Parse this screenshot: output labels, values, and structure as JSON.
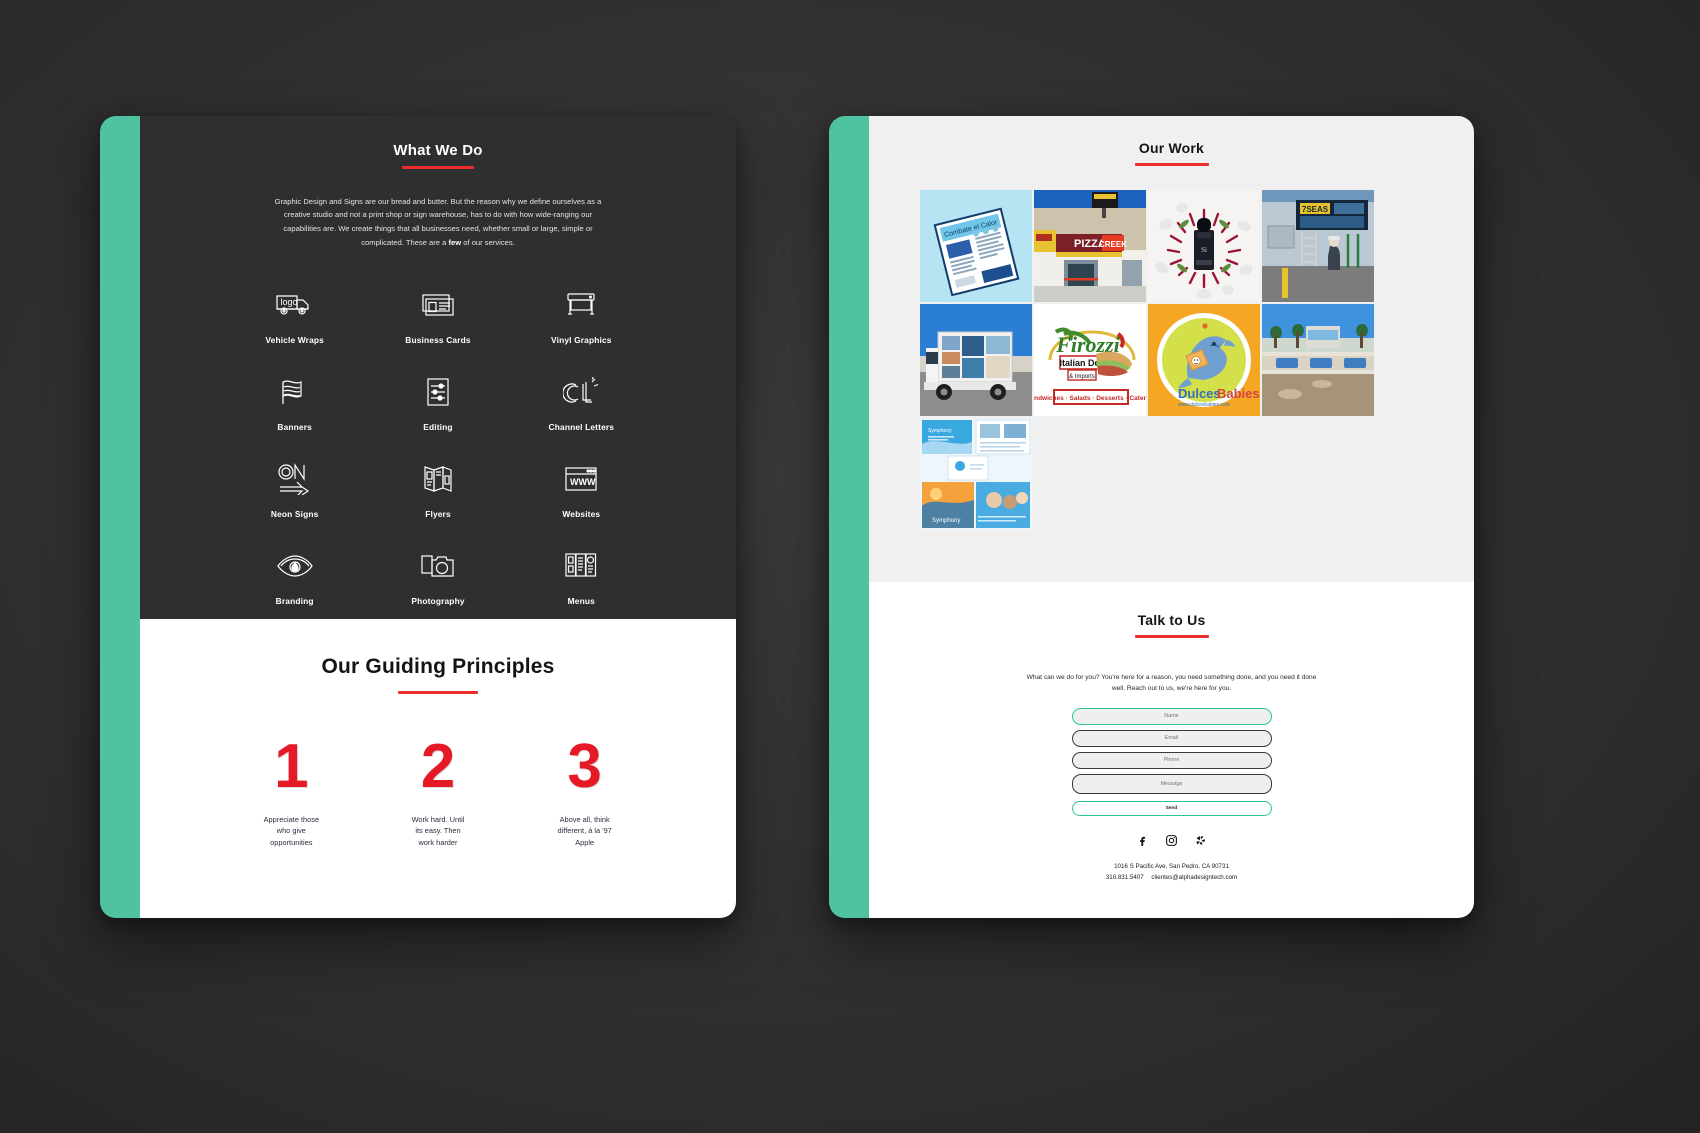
{
  "theme": {
    "accent_teal": "#4fc3a1",
    "accent_red": "#ee2b2b",
    "dark_bg": "#2f2f2f",
    "page_bg": "#333333",
    "work_bg": "#f0f0f0"
  },
  "left_card": {
    "what_we_do": {
      "title": "What We Do",
      "intro_part1": "Graphic Design and Signs are our bread and butter. But the reason why we define ourselves as a creative studio and not a print shop or sign warehouse, has to do with how wide-ranging our capabilities are. We create things that all businesses need, whether small or large, simple or complicated. These are a ",
      "intro_bold": "few",
      "intro_part2": " of our services.",
      "services": [
        {
          "label": "Vehicle Wraps",
          "icon": "truck-logo-icon"
        },
        {
          "label": "Business Cards",
          "icon": "business-card-icon"
        },
        {
          "label": "Vinyl Graphics",
          "icon": "large-format-printer-icon"
        },
        {
          "label": "Banners",
          "icon": "flag-banner-icon"
        },
        {
          "label": "Editing",
          "icon": "sliders-document-icon"
        },
        {
          "label": "Channel Letters",
          "icon": "channel-letters-cl-icon"
        },
        {
          "label": "Neon Signs",
          "icon": "neon-on-arrow-icon"
        },
        {
          "label": "Flyers",
          "icon": "trifold-flyer-icon"
        },
        {
          "label": "Websites",
          "icon": "browser-www-icon"
        },
        {
          "label": "Branding",
          "icon": "eye-icon"
        },
        {
          "label": "Photography",
          "icon": "camera-icon"
        },
        {
          "label": "Menus",
          "icon": "menu-trifold-icon"
        }
      ]
    },
    "guiding_principles": {
      "title": "Our Guiding Principles",
      "items": [
        {
          "number": "1",
          "text": "Appreciate those\nwho give\nopportunities"
        },
        {
          "number": "2",
          "text": "Work hard. Until\nits easy. Then\nwork harder"
        },
        {
          "number": "3",
          "text": "Above all, think\ndifferent, á la '97\nApple"
        }
      ]
    }
  },
  "right_card": {
    "our_work": {
      "title": "Our Work",
      "tiles": [
        {
          "name": "flyer-mockup-thumbnail",
          "caption": "Combate el Calor flyer mockup"
        },
        {
          "name": "pizza-creek-storefront-thumbnail",
          "caption": "PIZZA CREEK storefront sign"
        },
        {
          "name": "perfume-product-photo-thumbnail",
          "caption": "Si perfume bottle product photo"
        },
        {
          "name": "seven-seas-sign-install-thumbnail",
          "caption": "7 Seas sign installation"
        },
        {
          "name": "box-truck-wrap-thumbnail",
          "caption": "Box truck vehicle wrap"
        },
        {
          "name": "firozzi-deli-logo-thumbnail",
          "caption": "Firozzi Italian Deli logo"
        },
        {
          "name": "dulces-babies-logo-thumbnail",
          "caption": "DulcesBabies dolphin logo"
        },
        {
          "name": "beach-mural-thumbnail",
          "caption": "Beachfront mural"
        },
        {
          "name": "brand-collateral-thumbnail",
          "caption": "Brand collateral layouts"
        }
      ],
      "tile_text": {
        "pizza_sign": "PIZZA CREEK",
        "deli_name": "Firozzi",
        "deli_sub": "Italian Deli",
        "deli_sub2": "& Imports",
        "deli_strip": "Sandwiches · Salads · Desserts · Catering",
        "dulces_1": "Dulces",
        "dulces_2": "Babies",
        "dulces_url": "www.dulcesbabies.com",
        "seven_seas": "7SEAS",
        "perfume_label": "Si"
      }
    },
    "talk_to_us": {
      "title": "Talk to Us",
      "intro": "What can we do for you? You're here for a reason, you need something done, and you need it done well. Reach out to us, we're here for you.",
      "fields": [
        {
          "name": "name",
          "placeholder": "Name",
          "value": "",
          "focused": true
        },
        {
          "name": "email",
          "placeholder": "Email",
          "value": "",
          "focused": false
        },
        {
          "name": "phone",
          "placeholder": "Phone",
          "value": "",
          "focused": false
        },
        {
          "name": "message",
          "placeholder": "Message",
          "value": "",
          "focused": false
        }
      ],
      "send_label": "Send"
    },
    "footer": {
      "socials": [
        {
          "name": "facebook-icon",
          "label": "Facebook"
        },
        {
          "name": "instagram-icon",
          "label": "Instagram"
        },
        {
          "name": "yelp-icon",
          "label": "Yelp"
        }
      ],
      "address": "1016 S Pacific Ave, San Pedro, CA 90731",
      "phone": "310.831.5407",
      "email": "clientes@alphadesigntech.com"
    }
  }
}
